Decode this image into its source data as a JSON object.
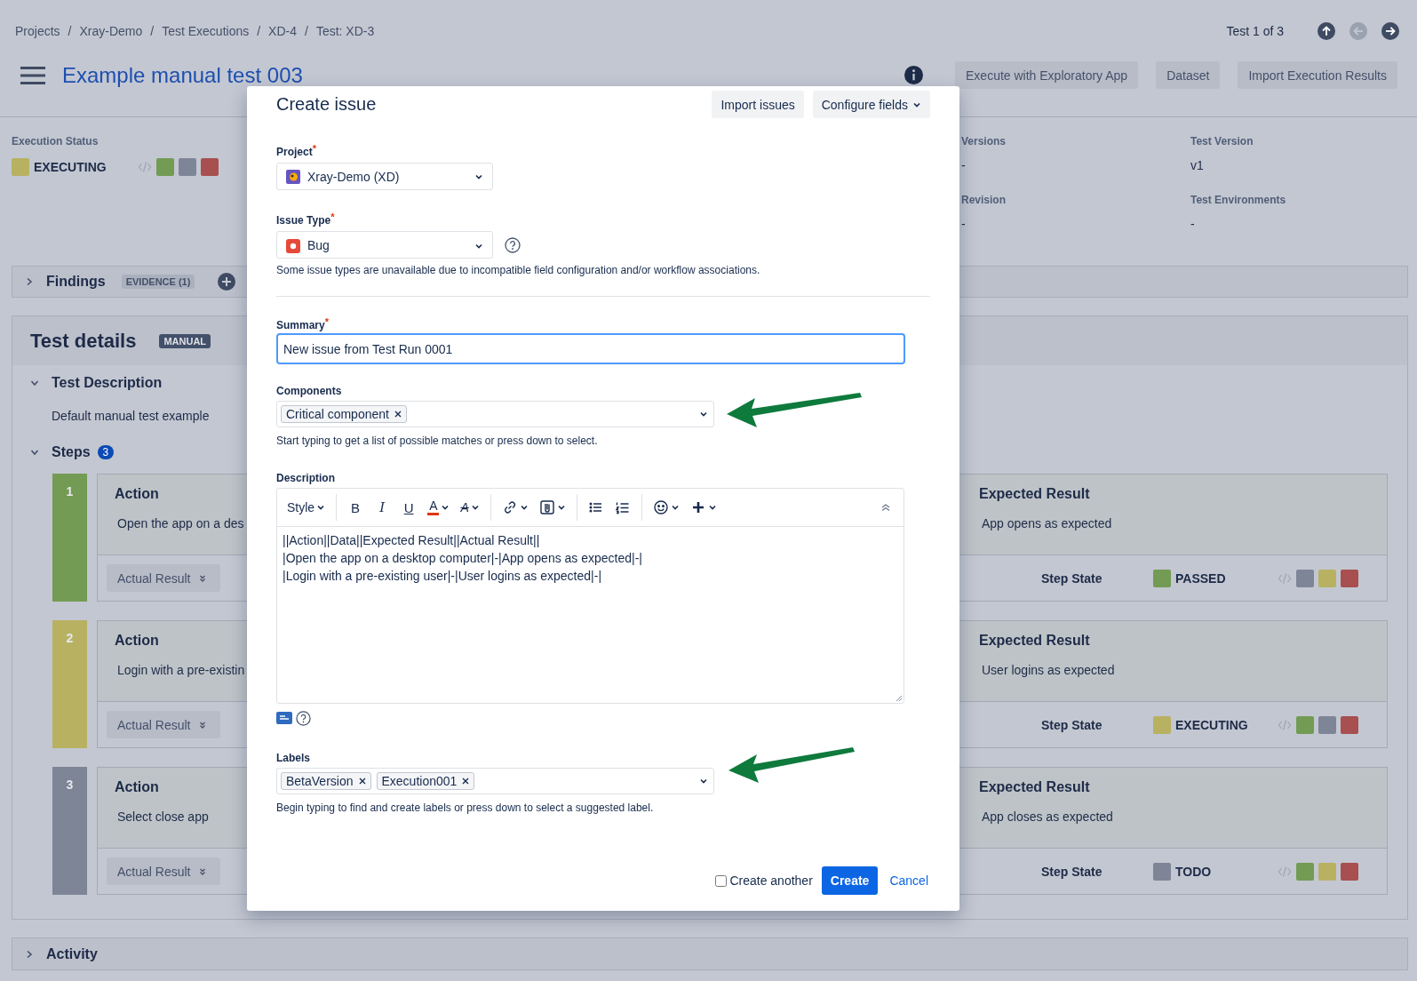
{
  "breadcrumb": {
    "separator": "/",
    "items": [
      "Projects",
      "Xray-Demo",
      "Test Executions",
      "XD-4",
      "Test: XD-3"
    ]
  },
  "pager": {
    "text": "Test 1 of 3",
    "buttons": [
      {
        "kind": "up",
        "disabled": false
      },
      {
        "kind": "previous",
        "disabled": true
      },
      {
        "kind": "next",
        "disabled": false
      }
    ]
  },
  "header": {
    "title": "Example manual test 003",
    "actions": [
      "Execute with Exploratory App",
      "Dataset",
      "Import Execution Results"
    ]
  },
  "execution_status": {
    "label": "Execution Status",
    "value": "EXECUTING",
    "color": "#b8b162",
    "options": [
      {
        "color": "#739b53"
      },
      {
        "color": "#7e8597"
      },
      {
        "color": "#a84f4f"
      }
    ]
  },
  "fields": [
    {
      "label": "Versions",
      "value": "-"
    },
    {
      "label": "Test Version",
      "value": "v1"
    },
    {
      "label": "Revision",
      "value": "-"
    },
    {
      "label": "Test Environments",
      "value": "-"
    }
  ],
  "findings": {
    "title": "Findings",
    "badge": "EVIDENCE (1)",
    "expanded": false
  },
  "test_details": {
    "title": "Test details",
    "badge": "MANUAL",
    "description_title": "Test Description",
    "description_expanded": true,
    "description": "Default manual test example",
    "steps_title": "Steps",
    "steps_expanded": true,
    "steps_count": "3"
  },
  "steps": [
    {
      "number": "1",
      "action_label": "Action",
      "action": "Open the app on a des",
      "expected_label": "Expected Result",
      "expected": "App opens as expected",
      "actual_button": "Actual Result",
      "state_label": "Step State",
      "state": {
        "value": "PASSED",
        "color": "#739b53"
      },
      "options": [
        {
          "color": "#7e8597"
        },
        {
          "color": "#b8b162"
        },
        {
          "color": "#a84f4f"
        }
      ]
    },
    {
      "number": "2",
      "action_label": "Action",
      "action": "Login with a pre-existin",
      "expected_label": "Expected Result",
      "expected": "User logins as expected",
      "actual_button": "Actual Result",
      "state_label": "Step State",
      "state": {
        "value": "EXECUTING",
        "color": "#b8b162"
      },
      "options": [
        {
          "color": "#739b53"
        },
        {
          "color": "#7e8597"
        },
        {
          "color": "#a84f4f"
        }
      ]
    },
    {
      "number": "3",
      "action_label": "Action",
      "action": "Select close app",
      "expected_label": "Expected Result",
      "expected": "App closes as expected",
      "actual_button": "Actual Result",
      "state_label": "Step State",
      "state": {
        "value": "TODO",
        "color": "#7e8597"
      },
      "options": [
        {
          "color": "#739b53"
        },
        {
          "color": "#b8b162"
        },
        {
          "color": "#a84f4f"
        }
      ]
    }
  ],
  "activity": {
    "title": "Activity",
    "expanded": false
  },
  "modal": {
    "title": "Create issue",
    "header_buttons": [
      {
        "label": "Import issues"
      },
      {
        "label": "Configure fields",
        "caret": true
      }
    ],
    "project": {
      "label": "Project",
      "marker": "*",
      "value": "Xray-Demo (XD)"
    },
    "issue_type": {
      "label": "Issue Type",
      "marker": "*",
      "value": "Bug",
      "help": true,
      "note": "Some issue types are unavailable due to incompatible field configuration and/or workflow associations."
    },
    "summary": {
      "label": "Summary",
      "marker": "*",
      "value": "New issue from Test Run 0001",
      "focused": true
    },
    "components": {
      "label": "Components",
      "chips": [
        "Critical component"
      ],
      "hint": "Start typing to get a list of possible matches or press down to select."
    },
    "description": {
      "label": "Description",
      "toolbar": [
        {
          "kind": "style",
          "label": "Style",
          "caret": true
        },
        {
          "kind": "separator"
        },
        {
          "kind": "bold",
          "label": "B"
        },
        {
          "kind": "italic",
          "label": "I"
        },
        {
          "kind": "underline",
          "label": "U"
        },
        {
          "kind": "text-color",
          "label": "A",
          "caret": true,
          "color": "#de350b"
        },
        {
          "kind": "text-size",
          "label": "A",
          "caret": true
        },
        {
          "kind": "separator"
        },
        {
          "kind": "link",
          "caret": true
        },
        {
          "kind": "attachment",
          "caret": true
        },
        {
          "kind": "separator"
        },
        {
          "kind": "bullet-list"
        },
        {
          "kind": "numbered-list"
        },
        {
          "kind": "separator"
        },
        {
          "kind": "emoji",
          "caret": true
        },
        {
          "kind": "insert",
          "caret": true
        }
      ],
      "value": "||Action||Data||Expected Result||Actual Result||\n|Open the app on a desktop computer|-|App opens as expected|-|\n|Login with a pre-existing user|-|User logins as expected|-|"
    },
    "labels": {
      "label": "Labels",
      "chips": [
        "BetaVersion",
        "Execution001"
      ],
      "hint": "Begin typing to find and create labels or press down to select a suggested label."
    },
    "create_another": {
      "label": "Create another",
      "checked": false
    },
    "submit": "Create",
    "cancel": "Cancel"
  }
}
